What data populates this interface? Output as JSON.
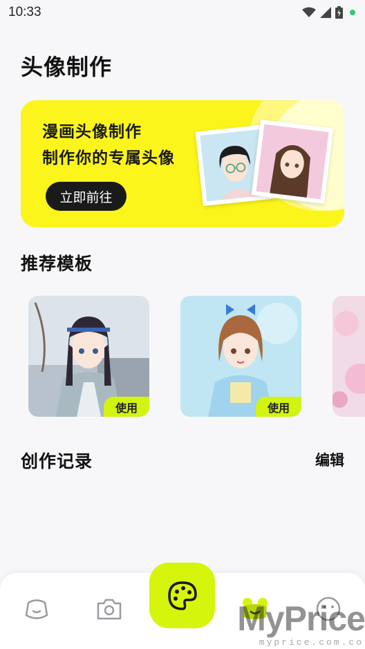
{
  "status_bar": {
    "time": "10:33"
  },
  "page_title": "头像制作",
  "banner": {
    "line1": "漫画头像制作",
    "line2": "制作你的专属头像",
    "button": "立即前往"
  },
  "templates": {
    "title": "推荐模板",
    "items": [
      {
        "use_label": "使用"
      },
      {
        "use_label": "使用"
      }
    ]
  },
  "records": {
    "title": "创作记录",
    "edit_label": "编辑"
  },
  "bottom_nav": {
    "items": [
      "face-icon",
      "camera-icon",
      "palette-icon",
      "frog-icon",
      "smile-icon"
    ],
    "accent": "#d6f50c"
  },
  "watermark": {
    "main": "MyPrice",
    "sub": "myprice.com.co"
  },
  "colors": {
    "banner_bg": "#fcf51b",
    "badge_bg": "#d3f410",
    "button_dark": "#1a1a1a"
  }
}
